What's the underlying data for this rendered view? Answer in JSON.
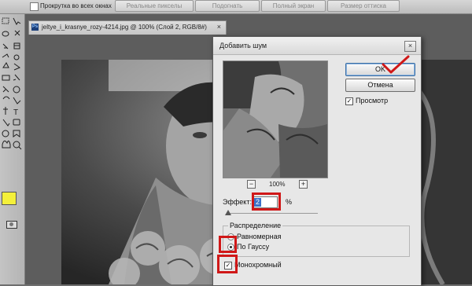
{
  "options_bar": {
    "scroll_all_label": "Прокрутка во всех окнах",
    "buttons": [
      "Реальные пикселы",
      "Подогнать",
      "Полный экран",
      "Размер оттиска"
    ]
  },
  "document": {
    "tab_title": "jeltye_i_krasnye_rozy-4214.jpg @ 100% (Слой 2, RGB/8#)",
    "ps_badge": "Ps",
    "close_glyph": "×"
  },
  "toolbox": {
    "foreground_color": "#f4f03a"
  },
  "dialog": {
    "title": "Добавить шум",
    "close_glyph": "×",
    "ok_label": "OK",
    "cancel_label": "Отмена",
    "preview_label": "Просмотр",
    "preview_checked": true,
    "zoom_minus": "−",
    "zoom_plus": "+",
    "zoom_value": "100%",
    "amount_label": "Эффект:",
    "amount_value": "2",
    "amount_unit": "%",
    "distribution_label": "Распределение",
    "uniform_label": "Равномерная",
    "gaussian_label": "По Гауссу",
    "gaussian_selected": true,
    "monochrome_label": "Монохромный",
    "monochrome_checked": true
  },
  "annotations": {
    "highlight_color": "#d01818",
    "ok_checkmark_color": "#d01818"
  }
}
